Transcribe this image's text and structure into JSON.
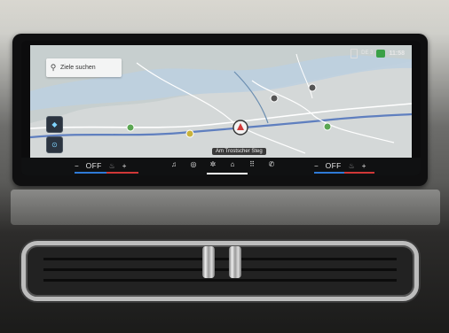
{
  "search": {
    "placeholder_text": "Ziele suchen",
    "icon": "search-icon"
  },
  "status_bar": {
    "network": "DE 3",
    "clock": "11:58"
  },
  "map": {
    "destination_label": "Am Trostscher Steg"
  },
  "climate_left": {
    "minus": "−",
    "state": "OFF",
    "plus": "+"
  },
  "climate_right": {
    "minus": "−",
    "state": "OFF",
    "plus": "+"
  },
  "dock": {
    "items": [
      {
        "icon": "music-icon",
        "glyph": "♫"
      },
      {
        "icon": "navigation-compass-icon",
        "glyph": "◎"
      },
      {
        "icon": "fan-icon",
        "glyph": "✲"
      },
      {
        "icon": "home-icon",
        "glyph": "⌂"
      },
      {
        "icon": "apps-grid-icon",
        "glyph": "⠿"
      },
      {
        "icon": "phone-icon",
        "glyph": "✆"
      }
    ]
  },
  "colors": {
    "accent_blue": "#2f7ad6",
    "accent_red": "#d03737",
    "status_ok": "#3aa047"
  }
}
